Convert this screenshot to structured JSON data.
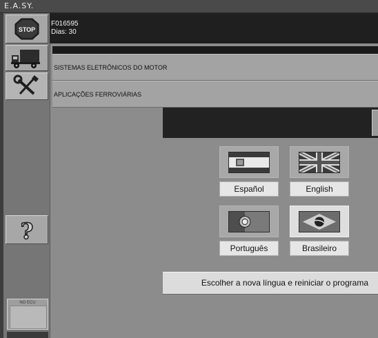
{
  "app": {
    "title": "E.A.SY."
  },
  "info": {
    "code": "F016595",
    "days": "Dias: 30"
  },
  "sidebar": {
    "stop_label": "STOP",
    "truck_icon": "truck-icon",
    "tools_icon": "tools-icon",
    "help_label": "?"
  },
  "menu": {
    "items": [
      {
        "label": "SISTEMAS ELETRÔNICOS DO MOTOR"
      },
      {
        "label": "APLICAÇÕES FERROVIÁRIAS"
      }
    ]
  },
  "languages": [
    {
      "label": "Español",
      "flag": "spain-flag",
      "selected": false
    },
    {
      "label": "English",
      "flag": "uk-flag",
      "selected": false
    },
    {
      "label": "Português",
      "flag": "portugal-flag",
      "selected": false
    },
    {
      "label": "Brasileiro",
      "flag": "brazil-flag",
      "selected": true
    }
  ],
  "confirm": {
    "label": "Escolher a nova língua e reiniciar o programa"
  },
  "status": {
    "ecu_label": "NO ECU"
  }
}
